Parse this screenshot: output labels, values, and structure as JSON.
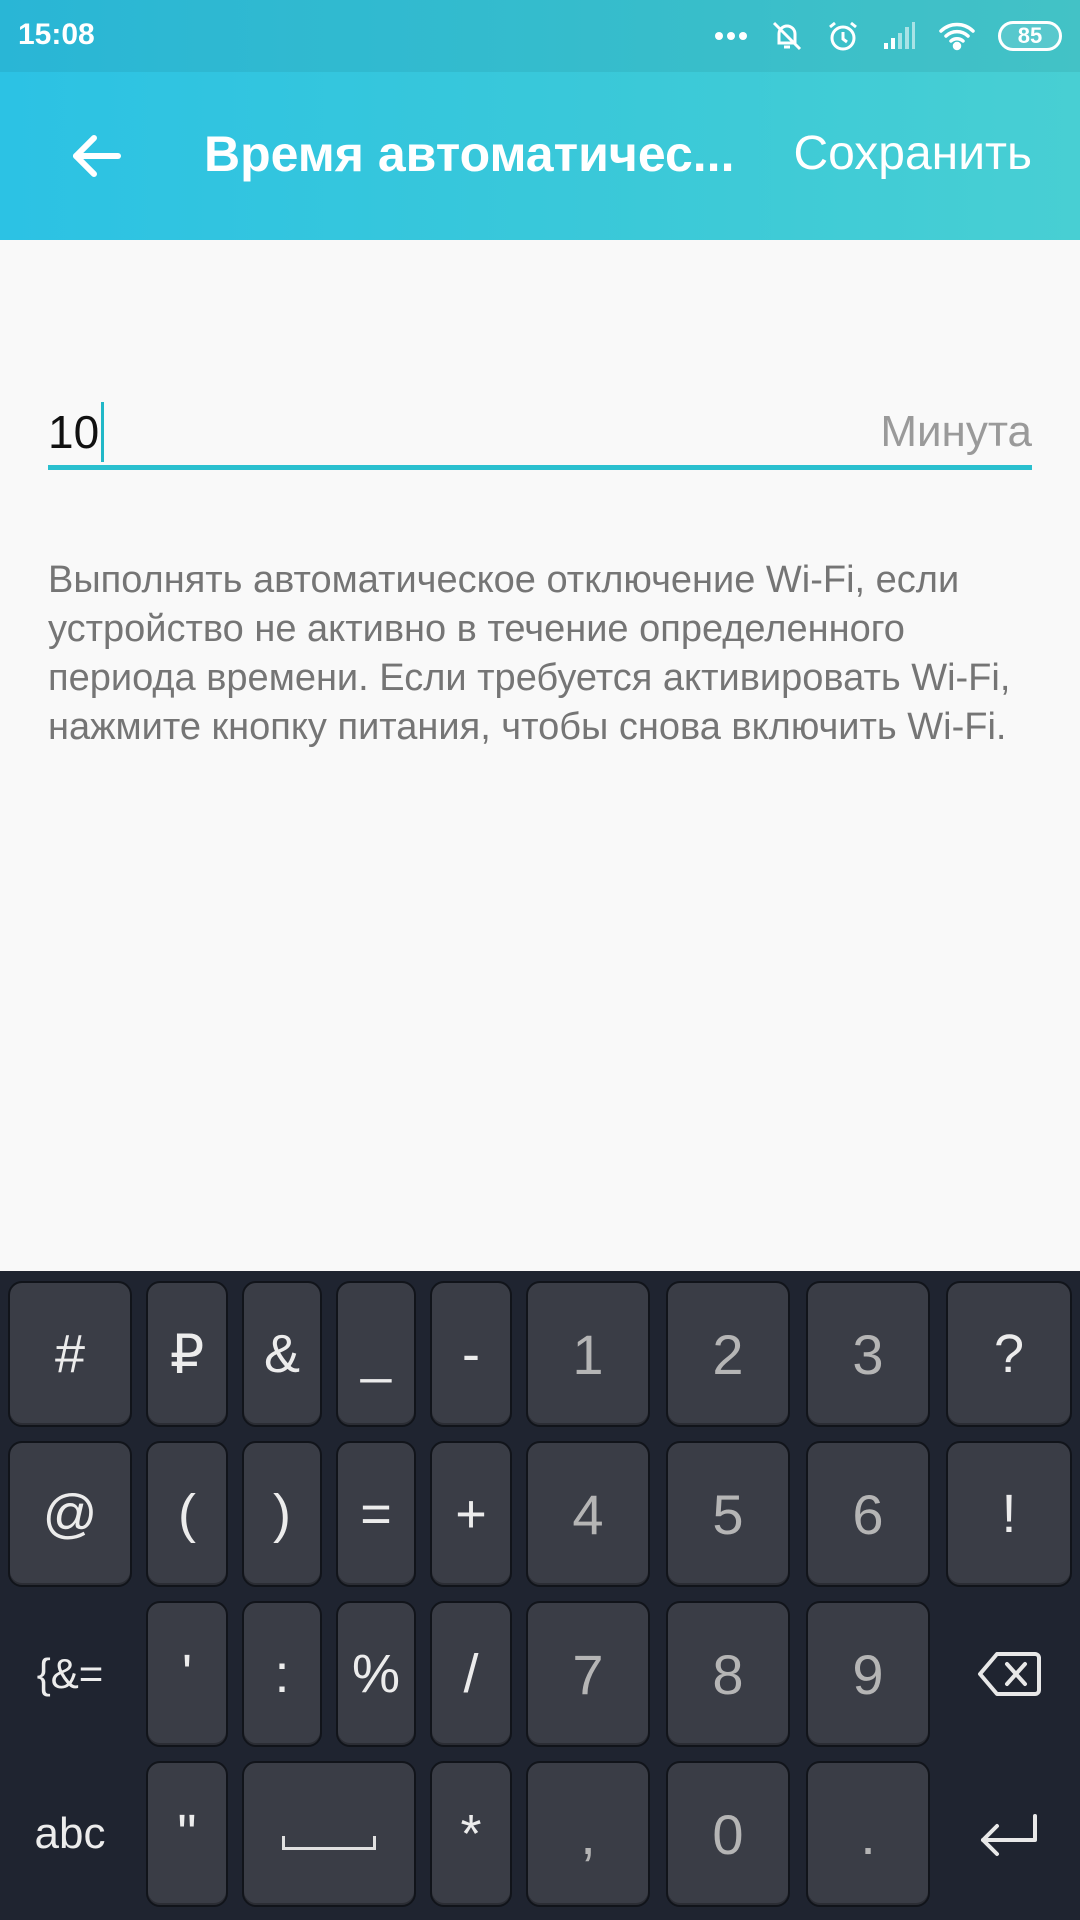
{
  "status_bar": {
    "time": "15:08",
    "battery": "85",
    "icons": [
      "more-dots-icon",
      "notifications-muted-icon",
      "alarm-icon",
      "cellular-signal-icon",
      "wifi-icon",
      "battery-icon"
    ]
  },
  "appbar": {
    "title": "Время автоматичес...",
    "save_label": "Сохранить",
    "back_icon": "back-arrow-icon"
  },
  "input": {
    "value": "10",
    "unit": "Минута"
  },
  "description": "Выполнять автоматическое отключение Wi-Fi, если устройство не активно в течение определенного периода времени. Если требуется активировать Wi-Fi, нажмите кнопку питания, чтобы снова включить Wi-Fi.",
  "keyboard": {
    "row1": [
      "#",
      "₽",
      "&",
      "_",
      "-",
      "1",
      "2",
      "3",
      "?"
    ],
    "row2": [
      "@",
      "(",
      ")",
      "=",
      "+",
      "4",
      "5",
      "6",
      "!"
    ],
    "row3": [
      "{&=",
      "'",
      ":",
      "%",
      "/",
      "7",
      "8",
      "9"
    ],
    "row4": [
      "abc",
      "\"",
      "*",
      ",",
      "0",
      "."
    ],
    "backspace_icon": "backspace-icon",
    "enter_icon": "enter-icon",
    "space_icon": "space-bar-icon"
  },
  "colors": {
    "header_start": "#2cc2e4",
    "header_end": "#48cfd3",
    "accent": "#2ac0cf",
    "keyboard_bg": "#1f2430",
    "key_bg": "#3a3d46"
  }
}
